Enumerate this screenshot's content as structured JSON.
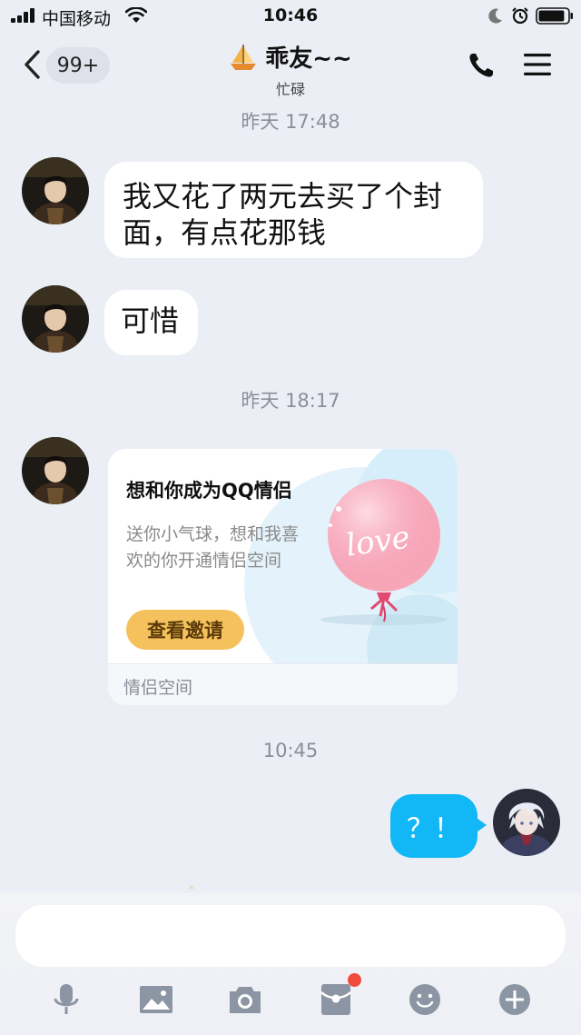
{
  "status_bar": {
    "carrier": "中国移动",
    "time": "10:46",
    "signal_icon": "signal-bars-icon",
    "wifi_icon": "wifi-icon",
    "moon_icon": "do-not-disturb-moon-icon",
    "alarm_icon": "alarm-clock-icon",
    "battery_level": 0.9
  },
  "nav": {
    "unread_count": "99+",
    "contact_name": "乖友~~",
    "contact_status": "忙碌",
    "icons": [
      "back-chevron-icon",
      "sailboat-icon",
      "phone-icon",
      "menu-icon"
    ]
  },
  "messages": [
    {
      "type": "timestamp",
      "text": "昨天 17:48"
    },
    {
      "type": "text",
      "from": "other",
      "lines": [
        "我又花了两元去买了个封",
        "面，有点花那钱"
      ]
    },
    {
      "type": "text",
      "from": "other",
      "text": "可惜"
    },
    {
      "type": "timestamp",
      "text": "昨天 18:17"
    },
    {
      "type": "card",
      "from": "other",
      "title": "想和你成为QQ情侣",
      "description": "送你小气球，想和我喜欢的你开通情侣空间",
      "button": "查看邀请",
      "balloon_text": "love",
      "footer": "情侣空间"
    },
    {
      "type": "timestamp",
      "text": "10:45"
    },
    {
      "type": "text",
      "from": "self",
      "text": "？！"
    }
  ],
  "input": {
    "value": "",
    "placeholder": ""
  },
  "toolbar": {
    "icons": [
      "microphone-icon",
      "image-icon",
      "camera-icon",
      "red-packet-icon",
      "emoji-icon",
      "plus-icon"
    ],
    "badge_color": "#f04b3c"
  },
  "colors": {
    "self_bubble": "#12b7f5",
    "other_bubble": "#ffffff",
    "background": "#eceef5",
    "button": "#f5c15c"
  }
}
